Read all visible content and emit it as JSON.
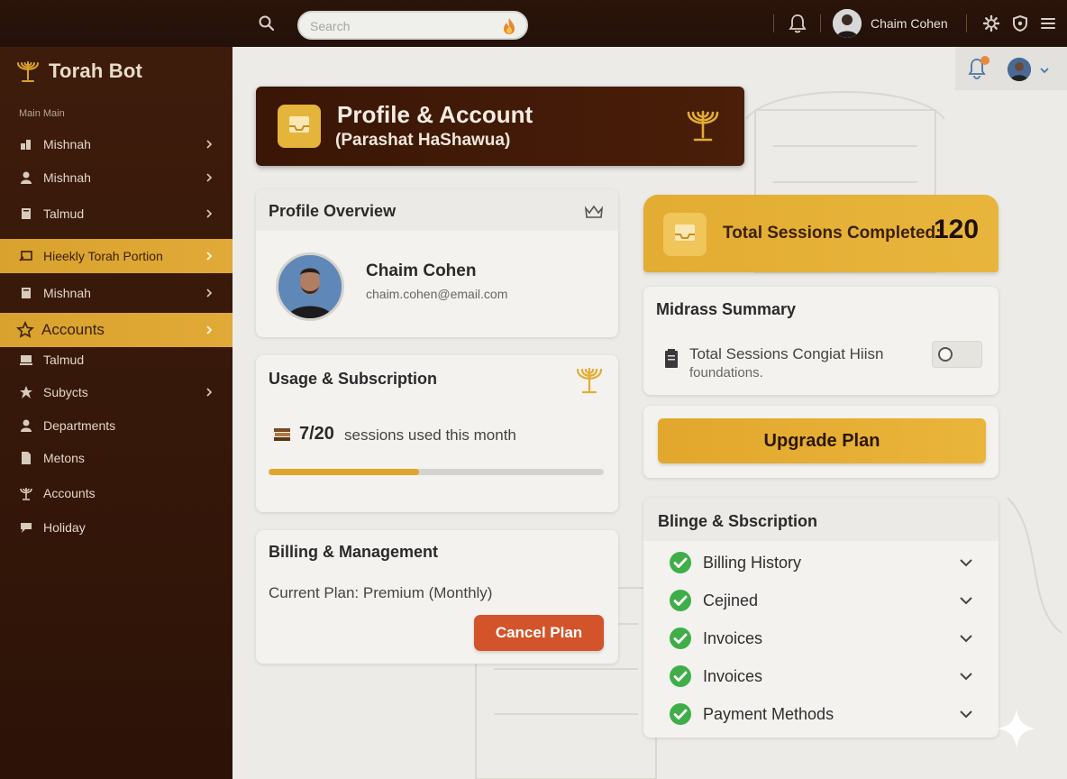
{
  "topbar": {
    "search_placeholder": "Search",
    "user_name": "Chaim Cohen"
  },
  "sidebar": {
    "brand": "Torah Bot",
    "section_label": "Main Main",
    "items": [
      {
        "label": "Mishnah",
        "icon": "users-icon",
        "active": false
      },
      {
        "label": "Mishnah",
        "icon": "person-icon",
        "active": false
      },
      {
        "label": "Talmud",
        "icon": "book-icon",
        "active": false
      },
      {
        "label": "Hieekly Torah Portion",
        "icon": "scroll-icon",
        "active": true
      },
      {
        "label": "Mishnah",
        "icon": "book-icon",
        "active": false
      },
      {
        "label": "Accounts",
        "icon": "star-icon",
        "active": true
      },
      {
        "label": "Talmud",
        "icon": "laptop-icon",
        "active": false
      },
      {
        "label": "Subycts",
        "icon": "tag-icon",
        "active": false
      },
      {
        "label": "Departments",
        "icon": "person-icon",
        "active": false
      },
      {
        "label": "Metons",
        "icon": "document-icon",
        "active": false
      },
      {
        "label": "Accounts",
        "icon": "menorah-icon",
        "active": false
      },
      {
        "label": "Holiday",
        "icon": "chat-icon",
        "active": false
      }
    ]
  },
  "header": {
    "title": "Profile & Account",
    "subtitle": "(Parashat HaShawua)"
  },
  "profile": {
    "title": "Profile Overview",
    "name": "Chaim Cohen",
    "email": "chaim.cohen@email.com"
  },
  "usage": {
    "title": "Usage & Subscription",
    "count": "7/20",
    "text": "sessions used this month",
    "progress_fraction": 0.45
  },
  "billing": {
    "title": "Billing & Management",
    "plan": "Current Plan: Premium (Monthly)",
    "cancel_label": "Cancel Plan"
  },
  "sessions": {
    "label": "Total Sessions Completed:",
    "value": "120"
  },
  "midrash": {
    "title": "Midrass Summary",
    "line1": "Total Sessions Congiat Hiisn",
    "line2": "foundations."
  },
  "upgrade": {
    "label": "Upgrade Plan"
  },
  "blinge": {
    "title": "Blinge & Sbscription",
    "rows": [
      "Billing History",
      "Cejined",
      "Invoices",
      "Invoices",
      "Payment Methods"
    ]
  },
  "colors": {
    "accent": "#e3ac32",
    "brand_dark": "#3a1606",
    "danger": "#d3542a",
    "success": "#3fae49"
  }
}
